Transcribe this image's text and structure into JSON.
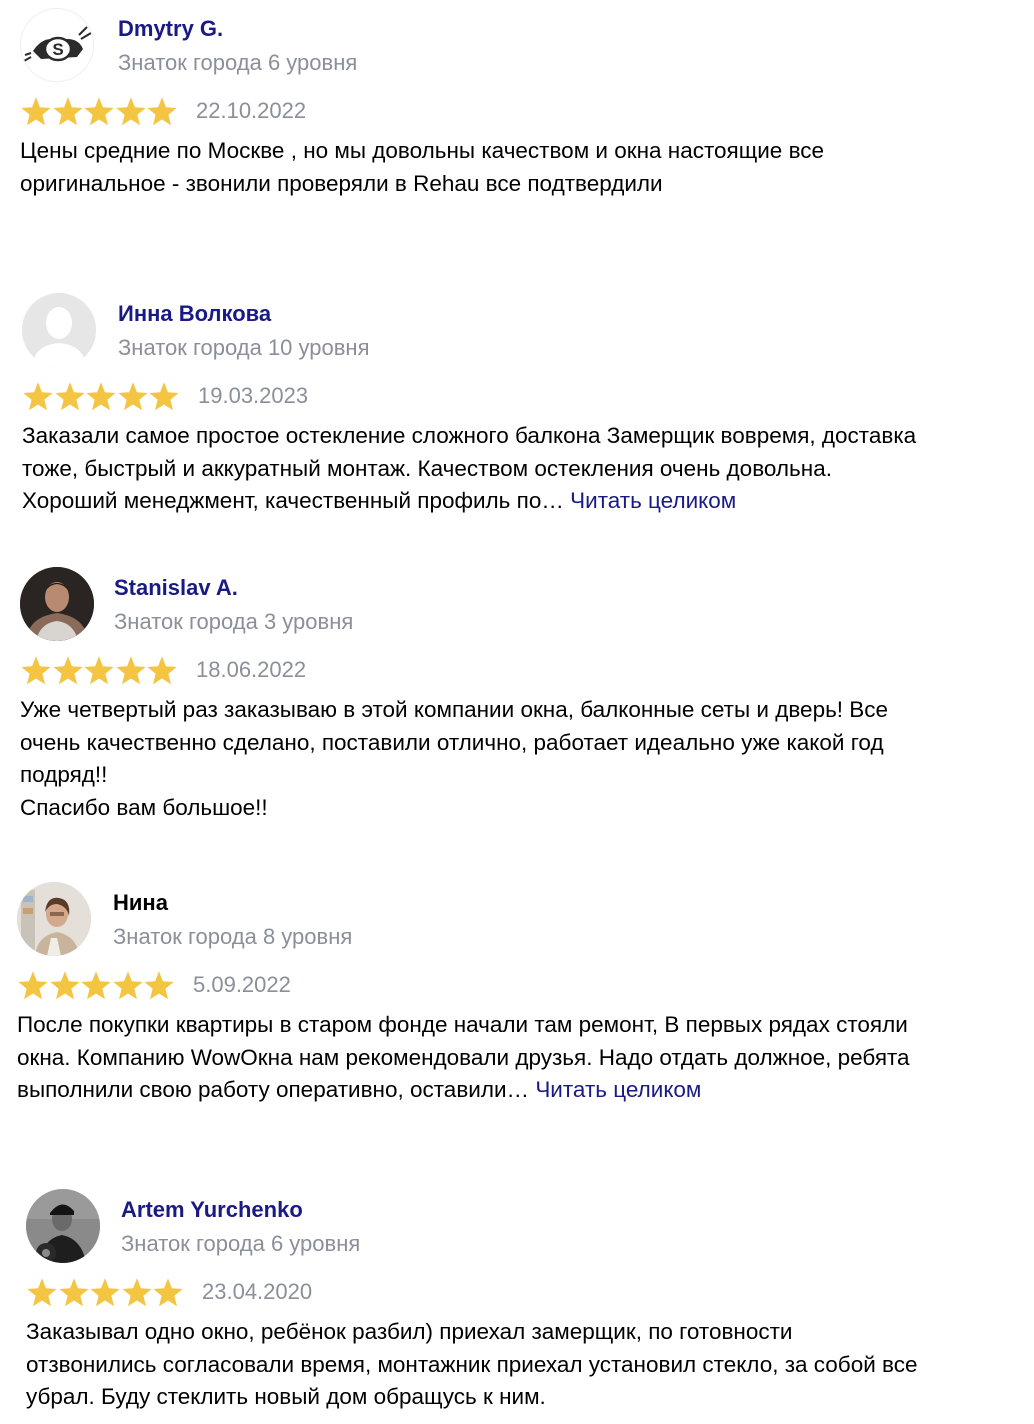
{
  "colors": {
    "author_link": "#1a1a84",
    "muted": "#8a8f99",
    "star": "#f4c542",
    "read_more": "#1a1a84"
  },
  "reviews": [
    {
      "author": "Dmytry G.",
      "level": "Знаток города 6 уровня",
      "rating": 5,
      "date": "22.10.2022",
      "text": "Цены средние по Москве , но мы довольны качеством и окна настоящие все\nоригинальное - звонили проверяли в Rehau все подтвердили",
      "read_more": "",
      "avatar_icon": "logo-s-avatar-icon"
    },
    {
      "author": "Инна Волкова",
      "level": "Знаток города 10 уровня",
      "rating": 5,
      "date": "19.03.2023",
      "text": "Заказали самое простое остекление сложного балкона Замерщик вовремя, доставка\nтоже, быстрый и аккуратный монтаж. Качеством остекления очень довольна.\nХороший менеджмент, качественный профиль по…",
      "read_more": "Читать целиком",
      "avatar_icon": "default-user-avatar-icon"
    },
    {
      "author": "Stanislav A.",
      "level": "Знаток города 3 уровня",
      "rating": 5,
      "date": "18.06.2022",
      "text": "Уже четвертый раз заказываю в этой компании окна, балконные сеты и дверь! Все\nочень качественно сделано, поставили отлично, работает идеально уже какой год\nподряд!!\nСпасибо вам большое!!",
      "read_more": "",
      "avatar_icon": "photo-avatar-icon"
    },
    {
      "author": "Нина",
      "level": "Знаток города 8 уровня",
      "rating": 5,
      "date": "5.09.2022",
      "text": "После покупки квартиры в старом фонде начали там ремонт, В первых рядах стояли\nокна. Компанию WowОкна нам рекомендовали друзья. Надо отдать должное, ребята\nвыполнили свою работу оперативно, оставили…",
      "read_more": "Читать целиком",
      "avatar_icon": "photo-avatar-icon"
    },
    {
      "author": "Artem Yurchenko",
      "level": "Знаток города 6 уровня",
      "rating": 5,
      "date": "23.04.2020",
      "text": "Заказывал одно окно, ребёнок разбил) приехал замерщик, по готовности\nотзвонились согласовали время, монтажник приехал установил стекло, за собой все\nубрал. Буду стеклить новый дом обращусь к ним.",
      "read_more": "",
      "avatar_icon": "photo-avatar-icon"
    }
  ]
}
